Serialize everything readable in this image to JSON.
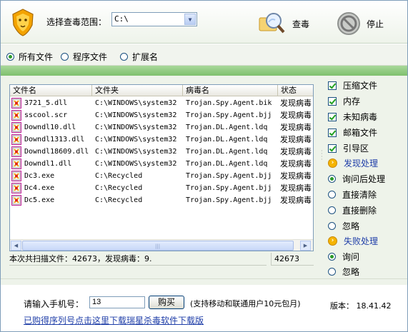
{
  "toolbar": {
    "scope_label": "选择查毒范围：",
    "scope_value": "C:\\",
    "scan_label": "查毒",
    "stop_label": "停止"
  },
  "file_types": {
    "all": "所有文件",
    "program": "程序文件",
    "extension": "扩展名",
    "selected": "all"
  },
  "table": {
    "columns": [
      "文件名",
      "文件夹",
      "病毒名",
      "状态"
    ],
    "rows": [
      [
        "3721_5.dll",
        "C:\\WINDOWS\\system32",
        "Trojan.Spy.Agent.bik",
        "发现病毒"
      ],
      [
        "sscool.scr",
        "C:\\WINDOWS\\system32",
        "Trojan.Spy.Agent.bjj",
        "发现病毒"
      ],
      [
        "Downdl10.dll",
        "C:\\WINDOWS\\system32",
        "Trojan.DL.Agent.ldq",
        "发现病毒"
      ],
      [
        "Downdl1313.dll",
        "C:\\WINDOWS\\system32",
        "Trojan.DL.Agent.ldq",
        "发现病毒"
      ],
      [
        "Downdl18609.dll",
        "C:\\WINDOWS\\system32",
        "Trojan.DL.Agent.ldq",
        "发现病毒"
      ],
      [
        "Downdl1.dll",
        "C:\\WINDOWS\\system32",
        "Trojan.DL.Agent.ldq",
        "发现病毒"
      ],
      [
        "Dc3.exe",
        "C:\\Recycled",
        "Trojan.Spy.Agent.bjj",
        "发现病毒"
      ],
      [
        "Dc4.exe",
        "C:\\Recycled",
        "Trojan.Spy.Agent.bjj",
        "发现病毒"
      ],
      [
        "Dc5.exe",
        "C:\\Recycled",
        "Trojan.Spy.Agent.bjj",
        "发现病毒"
      ]
    ]
  },
  "status": {
    "summary": "本次共扫描文件：42673，发现病毒：9.",
    "count": "42673"
  },
  "side": {
    "options": [
      {
        "label": "压缩文件",
        "checked": true
      },
      {
        "label": "内存",
        "checked": true
      },
      {
        "label": "未知病毒",
        "checked": true
      },
      {
        "label": "邮箱文件",
        "checked": true
      },
      {
        "label": "引导区",
        "checked": true
      }
    ],
    "found_title": "发现处理",
    "found_options": [
      {
        "label": "询问后处理",
        "selected": true
      },
      {
        "label": "直接清除",
        "selected": false
      },
      {
        "label": "直接删除",
        "selected": false
      },
      {
        "label": "忽略",
        "selected": false
      }
    ],
    "fail_title": "失败处理",
    "fail_options": [
      {
        "label": "询问",
        "selected": true
      },
      {
        "label": "忽略",
        "selected": false
      }
    ]
  },
  "bottom": {
    "phone_label": "请输入手机号：",
    "phone_value": "13",
    "buy_label": "购买",
    "buy_note": "(支持移动和联通用户10元包月)",
    "version": "版本：  18.41.42",
    "download_link": "已购得序列号点击这里下载瑞星杀毒软件下载版"
  },
  "colors": {
    "accent_green": "#7fc06d",
    "link_blue": "#1f3ea8",
    "icon_border": "#c0209a"
  }
}
